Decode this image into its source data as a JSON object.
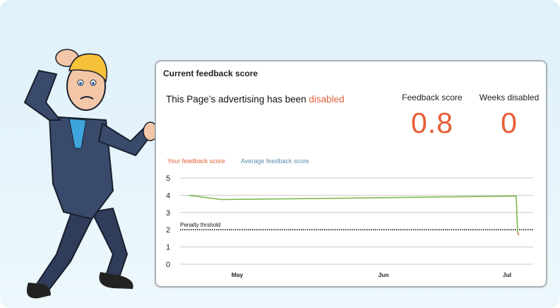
{
  "card": {
    "title": "Current feedback score",
    "status_prefix": "This Page’s advertising has been ",
    "status_word": "disabled"
  },
  "metrics": [
    {
      "label": "Feedback score",
      "value": "0.8"
    },
    {
      "label": "Weeks disabled",
      "value": "0"
    }
  ],
  "legend": [
    {
      "label": "Your feedback score",
      "color": "#e2623d"
    },
    {
      "label": "Average feedback score",
      "color": "#5b8fae"
    }
  ],
  "colors": {
    "accent": "#e95d34",
    "series_line": "#7cb84a",
    "grid": "#c9c9c9",
    "penalty": "#111111"
  },
  "chart_data": {
    "type": "line",
    "ylim": [
      0,
      5
    ],
    "y_ticks": [
      "0",
      "1",
      "2",
      "3",
      "4",
      "5"
    ],
    "x_ticks": [
      "May",
      "Jun",
      "Jul"
    ],
    "penalty_label": "Penalty thrshold",
    "penalty_value": 2,
    "series": [
      {
        "values": [
          4.0,
          3.75,
          3.8,
          3.85,
          3.9,
          3.95,
          1.8
        ],
        "segment_colors": [
          "#7cb84a",
          "#7cb84a",
          "#7cb84a",
          "#7cb84a",
          "#7cb84a",
          "#7cb84a"
        ],
        "end_color": "#e2623d",
        "end_value": 1.7
      }
    ]
  }
}
